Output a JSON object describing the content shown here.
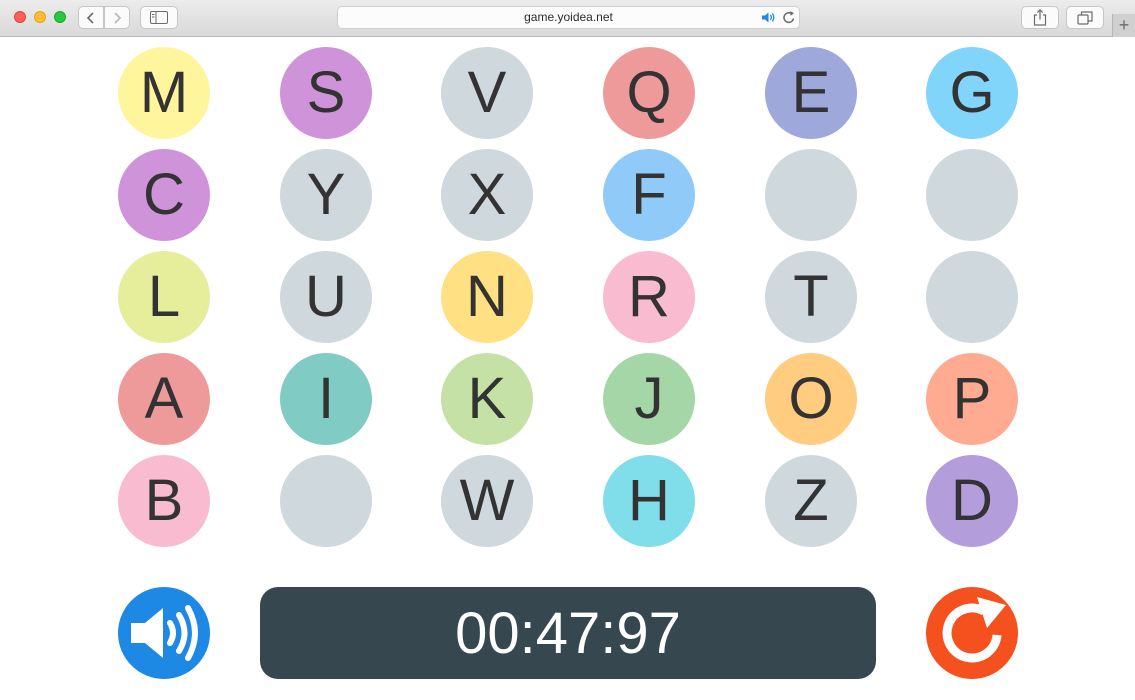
{
  "browser": {
    "url": "game.yoidea.net"
  },
  "tiles": [
    {
      "letter": "M",
      "color": "#fff59d"
    },
    {
      "letter": "S",
      "color": "#ce93d8"
    },
    {
      "letter": "V",
      "color": "#cfd8dc"
    },
    {
      "letter": "Q",
      "color": "#ef9a9a"
    },
    {
      "letter": "E",
      "color": "#9fa8da"
    },
    {
      "letter": "G",
      "color": "#81d4fa"
    },
    {
      "letter": "C",
      "color": "#ce93d8"
    },
    {
      "letter": "Y",
      "color": "#cfd8dc"
    },
    {
      "letter": "X",
      "color": "#cfd8dc"
    },
    {
      "letter": "F",
      "color": "#90caf9"
    },
    {
      "letter": "",
      "color": "#cfd8dc"
    },
    {
      "letter": "",
      "color": "#cfd8dc"
    },
    {
      "letter": "L",
      "color": "#e6ee9c"
    },
    {
      "letter": "U",
      "color": "#cfd8dc"
    },
    {
      "letter": "N",
      "color": "#ffe082"
    },
    {
      "letter": "R",
      "color": "#f8bbd0"
    },
    {
      "letter": "T",
      "color": "#cfd8dc"
    },
    {
      "letter": "",
      "color": "#cfd8dc"
    },
    {
      "letter": "A",
      "color": "#ef9a9a"
    },
    {
      "letter": "I",
      "color": "#80cbc4"
    },
    {
      "letter": "K",
      "color": "#c5e1a5"
    },
    {
      "letter": "J",
      "color": "#a5d6a7"
    },
    {
      "letter": "O",
      "color": "#ffcc80"
    },
    {
      "letter": "P",
      "color": "#ffab91"
    },
    {
      "letter": "B",
      "color": "#f8bbd0"
    },
    {
      "letter": "",
      "color": "#cfd8dc"
    },
    {
      "letter": "W",
      "color": "#cfd8dc"
    },
    {
      "letter": "H",
      "color": "#80deea"
    },
    {
      "letter": "Z",
      "color": "#cfd8dc"
    },
    {
      "letter": "D",
      "color": "#b39ddb"
    }
  ],
  "controls": {
    "sound_icon": "speaker-on-icon",
    "sound_color": "#1e88e5",
    "timer": "00:47:97",
    "timer_color": "#37474f",
    "restart_icon": "restart-icon",
    "restart_color": "#f4511e"
  }
}
